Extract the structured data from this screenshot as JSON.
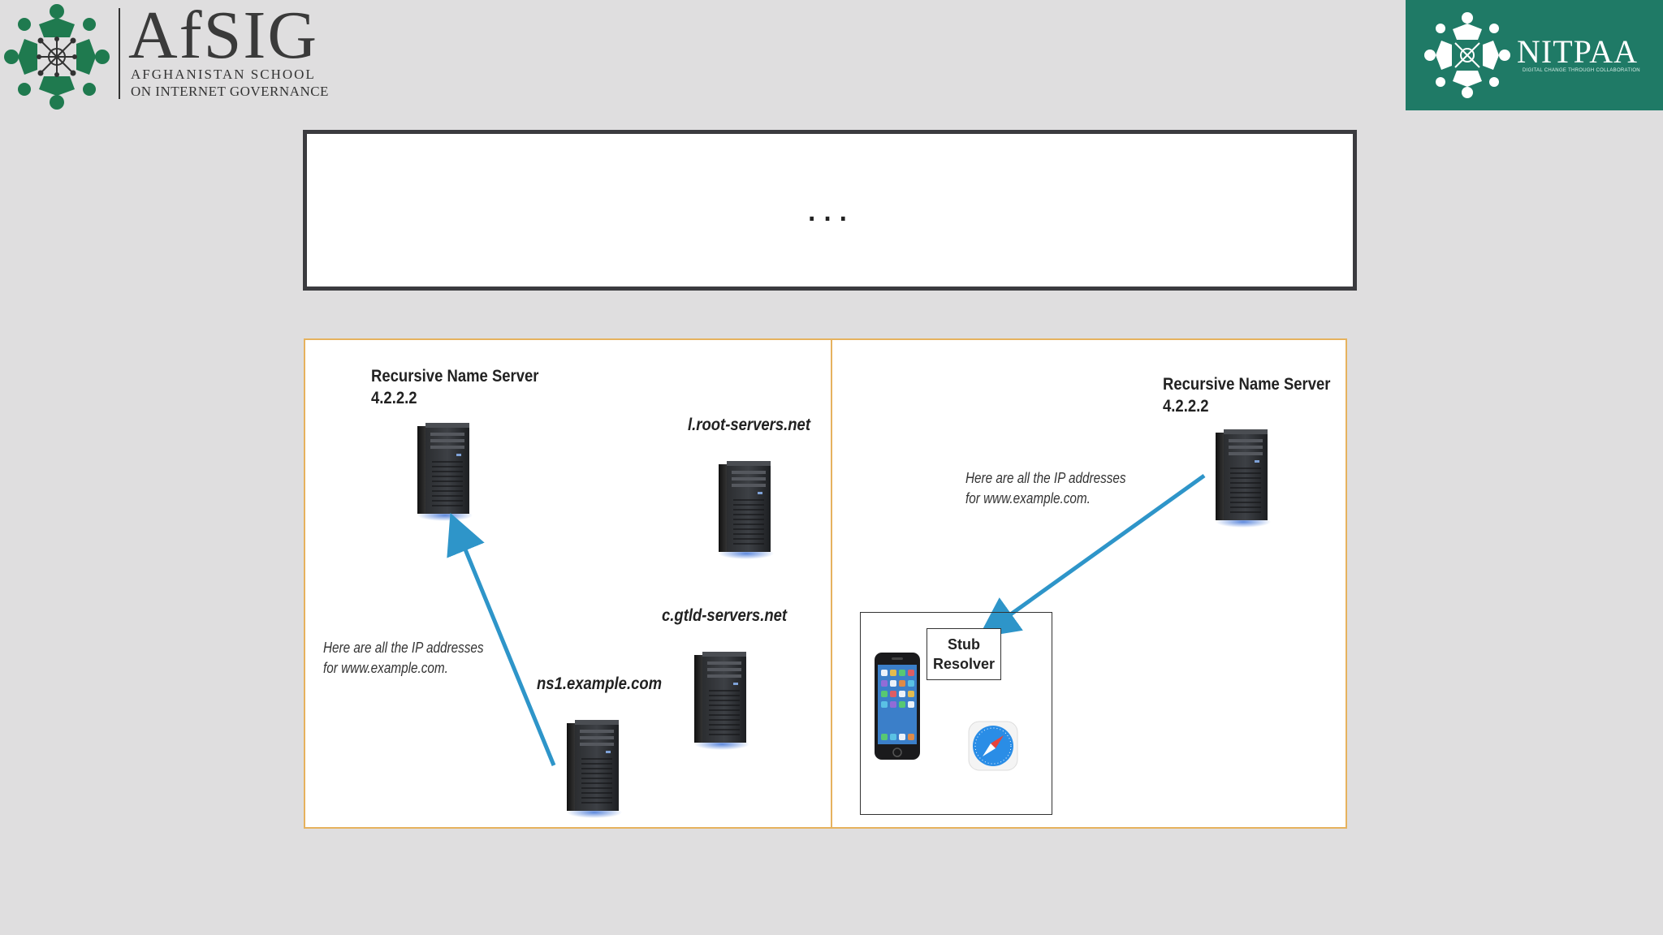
{
  "logos": {
    "afsig": {
      "name": "AfSIG",
      "line1": "AFGHANISTAN SCHOOL",
      "line2": "ON INTERNET GOVERNANCE",
      "color": "#1f7a4f"
    },
    "nitpaa": {
      "name": "NITPAA",
      "tagline": "DIGITAL CHANGE THROUGH COLLABORATION",
      "color": "#1f7a66"
    }
  },
  "title": "...",
  "diagram": {
    "left": {
      "recursive_server": {
        "line1": "Recursive Name Server",
        "line2": "4.2.2.2"
      },
      "root_server": "l.root-servers.net",
      "gtld_server": "c.gtld-servers.net",
      "ns1_server": "ns1.example.com",
      "note": {
        "line1": "Here are all the IP addresses",
        "line2": "for www.example.com."
      }
    },
    "right": {
      "recursive_server": {
        "line1": "Recursive Name Server",
        "line2": "4.2.2.2"
      },
      "note": {
        "line1": "Here are all the IP addresses",
        "line2": "for www.example.com."
      },
      "stub_resolver": "Stub\nResolver"
    },
    "arrow_color": "#2e95c9",
    "panel_border_color": "#e6b25e"
  }
}
